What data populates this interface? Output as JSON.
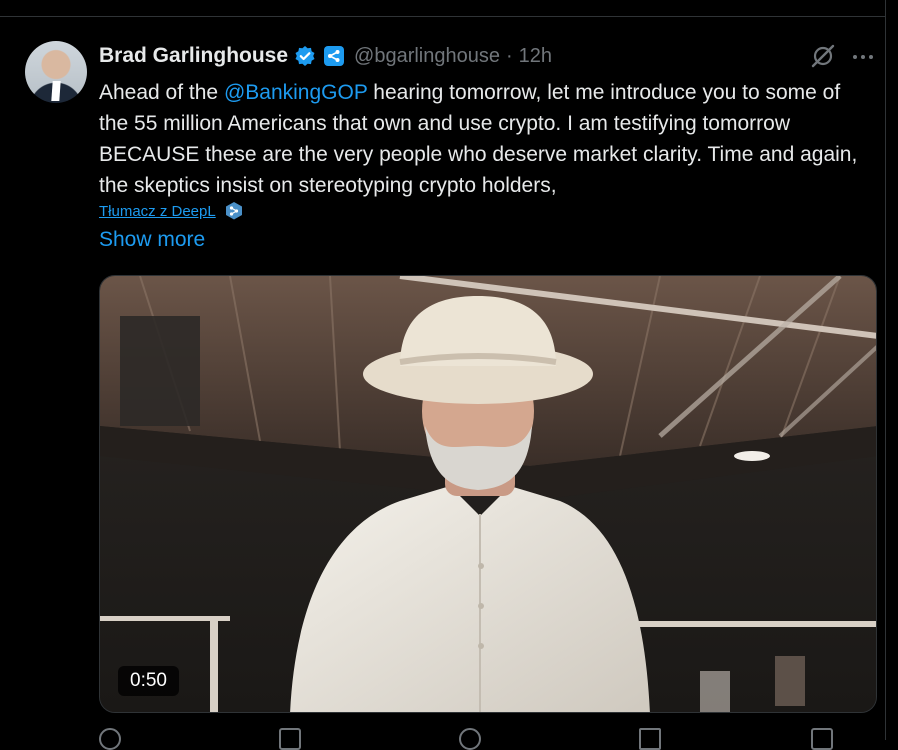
{
  "author": {
    "name": "Brad Garlinghouse",
    "handle": "@bgarlinghouse",
    "separator": "·",
    "time": "12h"
  },
  "tweet": {
    "text_before_mention": "Ahead of the ",
    "mention": "@BankingGOP",
    "text_after_mention": " hearing tomorrow, let me introduce you to some of the 55 million Americans that own and use crypto. I am testifying tomorrow BECAUSE these are the very people who deserve market clarity. Time and again, the skeptics insist on stereotyping crypto holders,",
    "translate_label": "Tłumacz z DeepL",
    "show_more": "Show more"
  },
  "media": {
    "type": "video",
    "duration": "0:50"
  },
  "icons": {
    "verified": "verified-badge-icon",
    "affiliate": "ripple-logo-icon",
    "grok": "grok-icon",
    "more": "more-icon",
    "deepl": "deepl-icon"
  },
  "colors": {
    "background": "#000000",
    "text": "#e7e9ea",
    "secondary": "#71767b",
    "accent": "#1d9bf0",
    "border": "#2f3336"
  }
}
